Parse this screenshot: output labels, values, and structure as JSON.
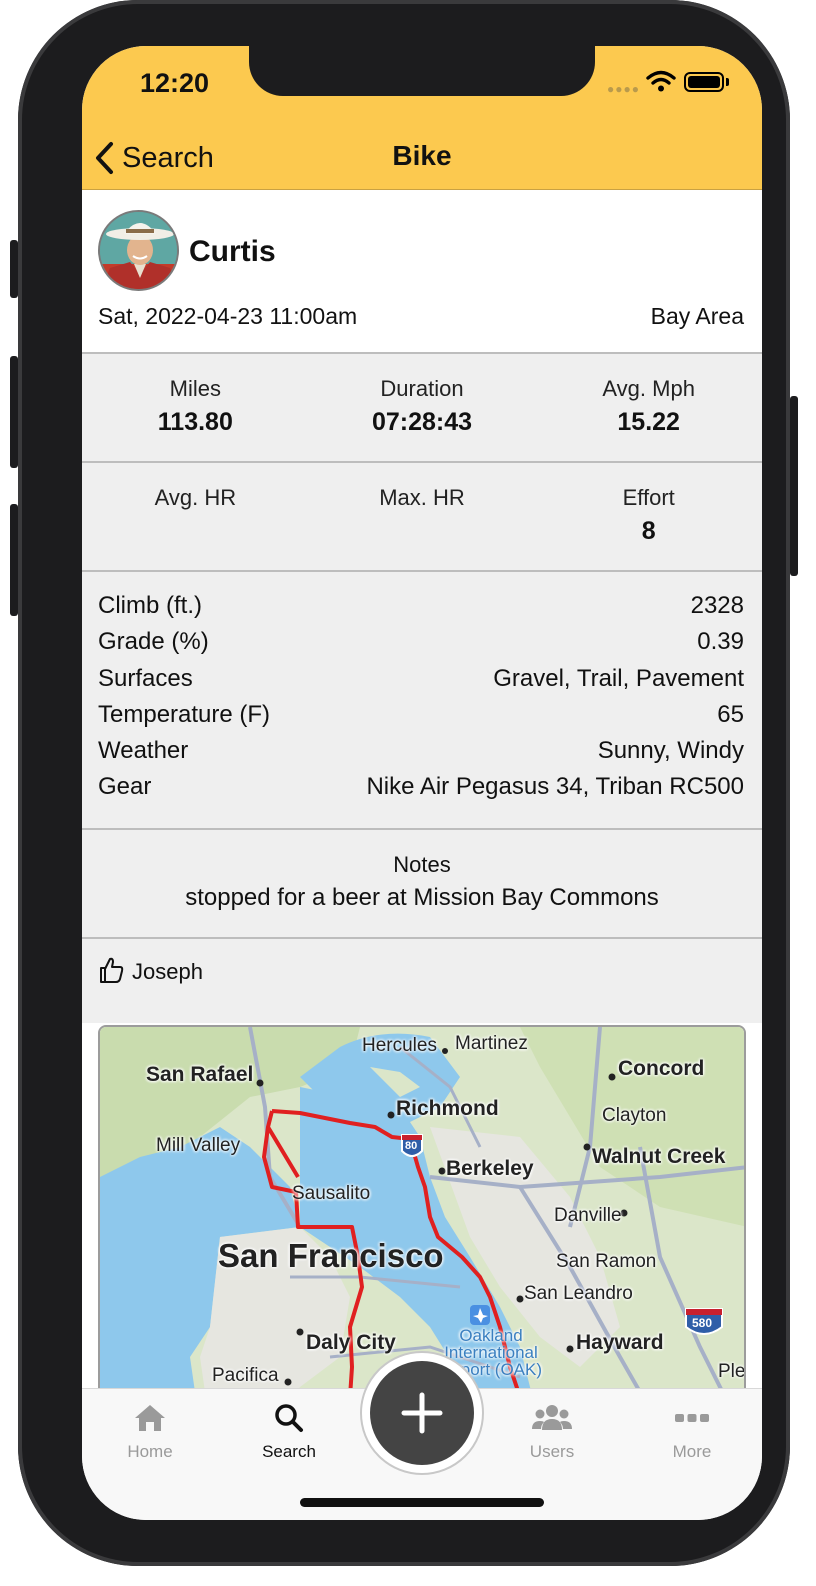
{
  "status": {
    "time": "12:20"
  },
  "nav": {
    "back_label": "Search",
    "title": "Bike"
  },
  "activity": {
    "user": "Curtis",
    "datetime": "Sat, 2022-04-23 11:00am",
    "region": "Bay Area",
    "stats_row1": [
      {
        "label": "Miles",
        "value": "113.80"
      },
      {
        "label": "Duration",
        "value": "07:28:43"
      },
      {
        "label": "Avg. Mph",
        "value": "15.22"
      }
    ],
    "stats_row2": [
      {
        "label": "Avg. HR",
        "value": ""
      },
      {
        "label": "Max. HR",
        "value": ""
      },
      {
        "label": "Effort",
        "value": "8"
      }
    ],
    "details": [
      {
        "label": "Climb (ft.)",
        "value": "2328"
      },
      {
        "label": "Grade (%)",
        "value": "0.39"
      },
      {
        "label": "Surfaces",
        "value": "Gravel, Trail, Pavement"
      },
      {
        "label": "Temperature (F)",
        "value": "65"
      },
      {
        "label": "Weather",
        "value": "Sunny, Windy"
      },
      {
        "label": "Gear",
        "value": "Nike Air Pegasus 34, Triban RC500"
      }
    ],
    "notes_label": "Notes",
    "notes": "stopped for a beer at Mission Bay Commons",
    "likes": [
      "Joseph"
    ]
  },
  "map": {
    "labels": {
      "hercules": "Hercules",
      "martinez": "Martinez",
      "concord": "Concord",
      "san_rafael": "San Rafael",
      "richmond": "Richmond",
      "clayton": "Clayton",
      "mill_valley": "Mill Valley",
      "berkeley": "Berkeley",
      "walnut_creek": "Walnut Creek",
      "sausalito": "Sausalito",
      "danville": "Danville",
      "san_francisco": "San Francisco",
      "san_ramon": "San Ramon",
      "san_leandro": "San Leandro",
      "daly_city": "Daly City",
      "oakland_airport": "Oakland International Airport (OAK)",
      "hayward": "Hayward",
      "pacifica": "Pacifica",
      "pleasanton": "Ple",
      "i580": "580",
      "i80": "80"
    },
    "route_color": "#e02020"
  },
  "tabs": [
    {
      "label": "Home",
      "icon": "home-icon",
      "active": false
    },
    {
      "label": "Search",
      "icon": "search-icon",
      "active": true
    },
    {
      "label": "Users",
      "icon": "users-icon",
      "active": false
    },
    {
      "label": "More",
      "icon": "more-icon",
      "active": false
    }
  ],
  "colors": {
    "header": "#fcc94f",
    "section_bg": "#efefef",
    "fab": "#444444"
  }
}
